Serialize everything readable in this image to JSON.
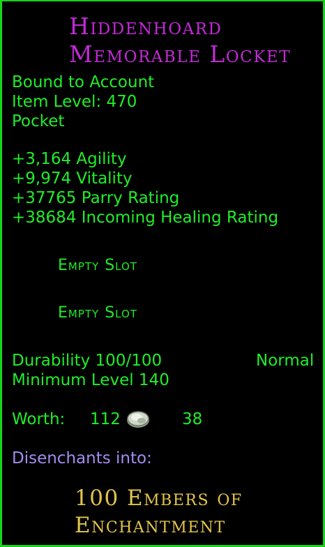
{
  "item": {
    "name_line1": "Hiddenhoard",
    "name_line2": "Memorable Locket",
    "bind": "Bound to Account",
    "item_level": "Item Level: 470",
    "slot_type": "Pocket"
  },
  "stats": [
    "+3,164 Agility",
    "+9,974 Vitality",
    "+37765 Parry Rating",
    "+38684 Incoming Healing Rating"
  ],
  "essence_slots": [
    "Empty Slot",
    "Empty Slot"
  ],
  "durability": {
    "text": "Durability 100/100",
    "quality": "Normal"
  },
  "min_level": "Minimum Level 140",
  "worth": {
    "label": "Worth:",
    "gold": "112",
    "silver": "38"
  },
  "disenchant": {
    "label": "Disenchants into:",
    "result_line1": "100 Embers of",
    "result_line2": "Enchantment"
  },
  "colors": {
    "border": "#16d51a",
    "stat_text": "#1fee28",
    "item_name": "#c22ad6",
    "disenchant_label": "#a48cf0",
    "ember": "#e3c64a"
  },
  "icons": [
    "silver-coin-icon"
  ]
}
